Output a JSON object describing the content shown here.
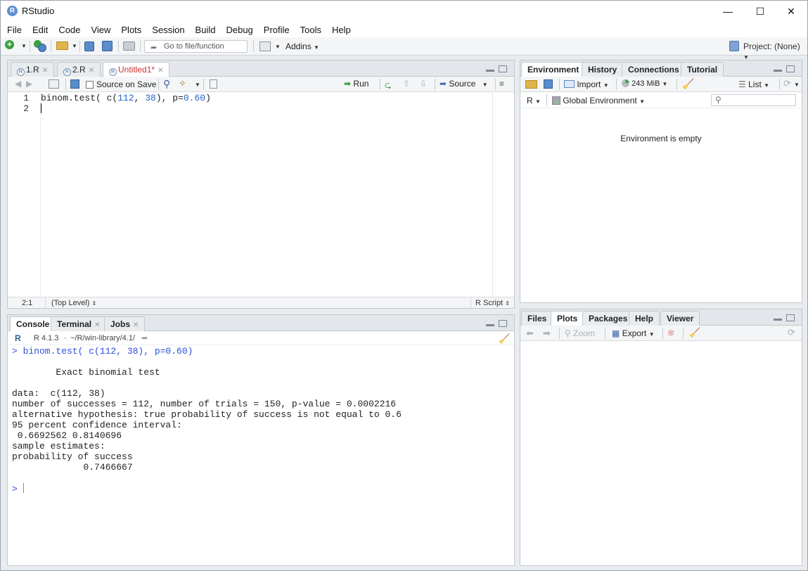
{
  "window": {
    "title": "RStudio",
    "logo_letter": "R",
    "controls": [
      "—",
      "☐",
      "✕"
    ]
  },
  "menu": [
    "File",
    "Edit",
    "Code",
    "View",
    "Plots",
    "Session",
    "Build",
    "Debug",
    "Profile",
    "Tools",
    "Help"
  ],
  "toolbar": {
    "goto_placeholder": "Go to file/function",
    "addins_label": "Addins",
    "project_label": "Project: (None)"
  },
  "editor": {
    "tabs": [
      {
        "label": "1.R",
        "modified": false
      },
      {
        "label": "2.R",
        "modified": false
      },
      {
        "label": "Untitled1*",
        "modified": true
      }
    ],
    "source_on_save": "Source on Save",
    "run_label": "Run",
    "source_label": "Source",
    "line_numbers": [
      "1",
      "2"
    ],
    "code": {
      "fn": "binom.test( c(",
      "n1": "112",
      "comma": ", ",
      "n2": "38",
      "mid": "), p=",
      "n3": "0.60",
      "end": ")"
    },
    "status": {
      "position": "2:1",
      "scope": "(Top Level)",
      "filetype": "R Script"
    }
  },
  "console": {
    "tabs": [
      "Console",
      "Terminal",
      "Jobs"
    ],
    "r_version": "R 4.1.3",
    "path": "~/R/win-library/4.1/",
    "command": "> binom.test( c(112, 38), p=0.60)",
    "output": [
      "",
      "        Exact binomial test",
      "",
      "data:  c(112, 38)",
      "number of successes = 112, number of trials = 150, p-value = 0.0002216",
      "alternative hypothesis: true probability of success is not equal to 0.6",
      "95 percent confidence interval:",
      " 0.6692562 0.8140696",
      "sample estimates:",
      "probability of success",
      "             0.7466667",
      ""
    ],
    "prompt": "> "
  },
  "environment": {
    "tabs": [
      "Environment",
      "History",
      "Connections",
      "Tutorial"
    ],
    "import_label": "Import",
    "memory_label": "243 MiB",
    "list_label": "List",
    "r_label": "R",
    "global_env_label": "Global Environment",
    "empty_message": "Environment is empty"
  },
  "files": {
    "tabs": [
      "Files",
      "Plots",
      "Packages",
      "Help",
      "Viewer"
    ],
    "zoom_label": "Zoom",
    "export_label": "Export"
  }
}
